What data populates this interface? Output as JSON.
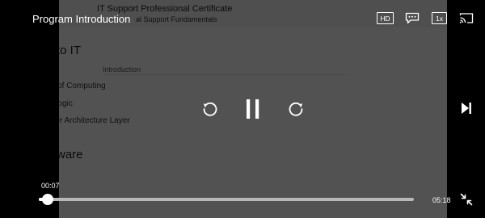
{
  "player": {
    "title": "Program Introduction",
    "quality_label": "HD",
    "speed_label": "1x",
    "elapsed": "00:07",
    "duration": "05:18",
    "progress_fraction": 0.023
  },
  "slide": {
    "certificate": "IT Support Professional Certificate",
    "course": "al Support Fundamentals",
    "heading_1": "to IT",
    "column_label": "Introduction",
    "items": [
      "ry of Computing",
      "l Logic",
      "uter Architecture Layer"
    ],
    "heading_2": "ware"
  },
  "icons": {
    "captions": "captions-icon",
    "cast": "cast-icon",
    "rewind": "replay-icon",
    "pause": "pause-icon",
    "forward": "forward-icon",
    "next": "skip-next-icon",
    "exit_fullscreen": "exit-fullscreen-icon"
  }
}
